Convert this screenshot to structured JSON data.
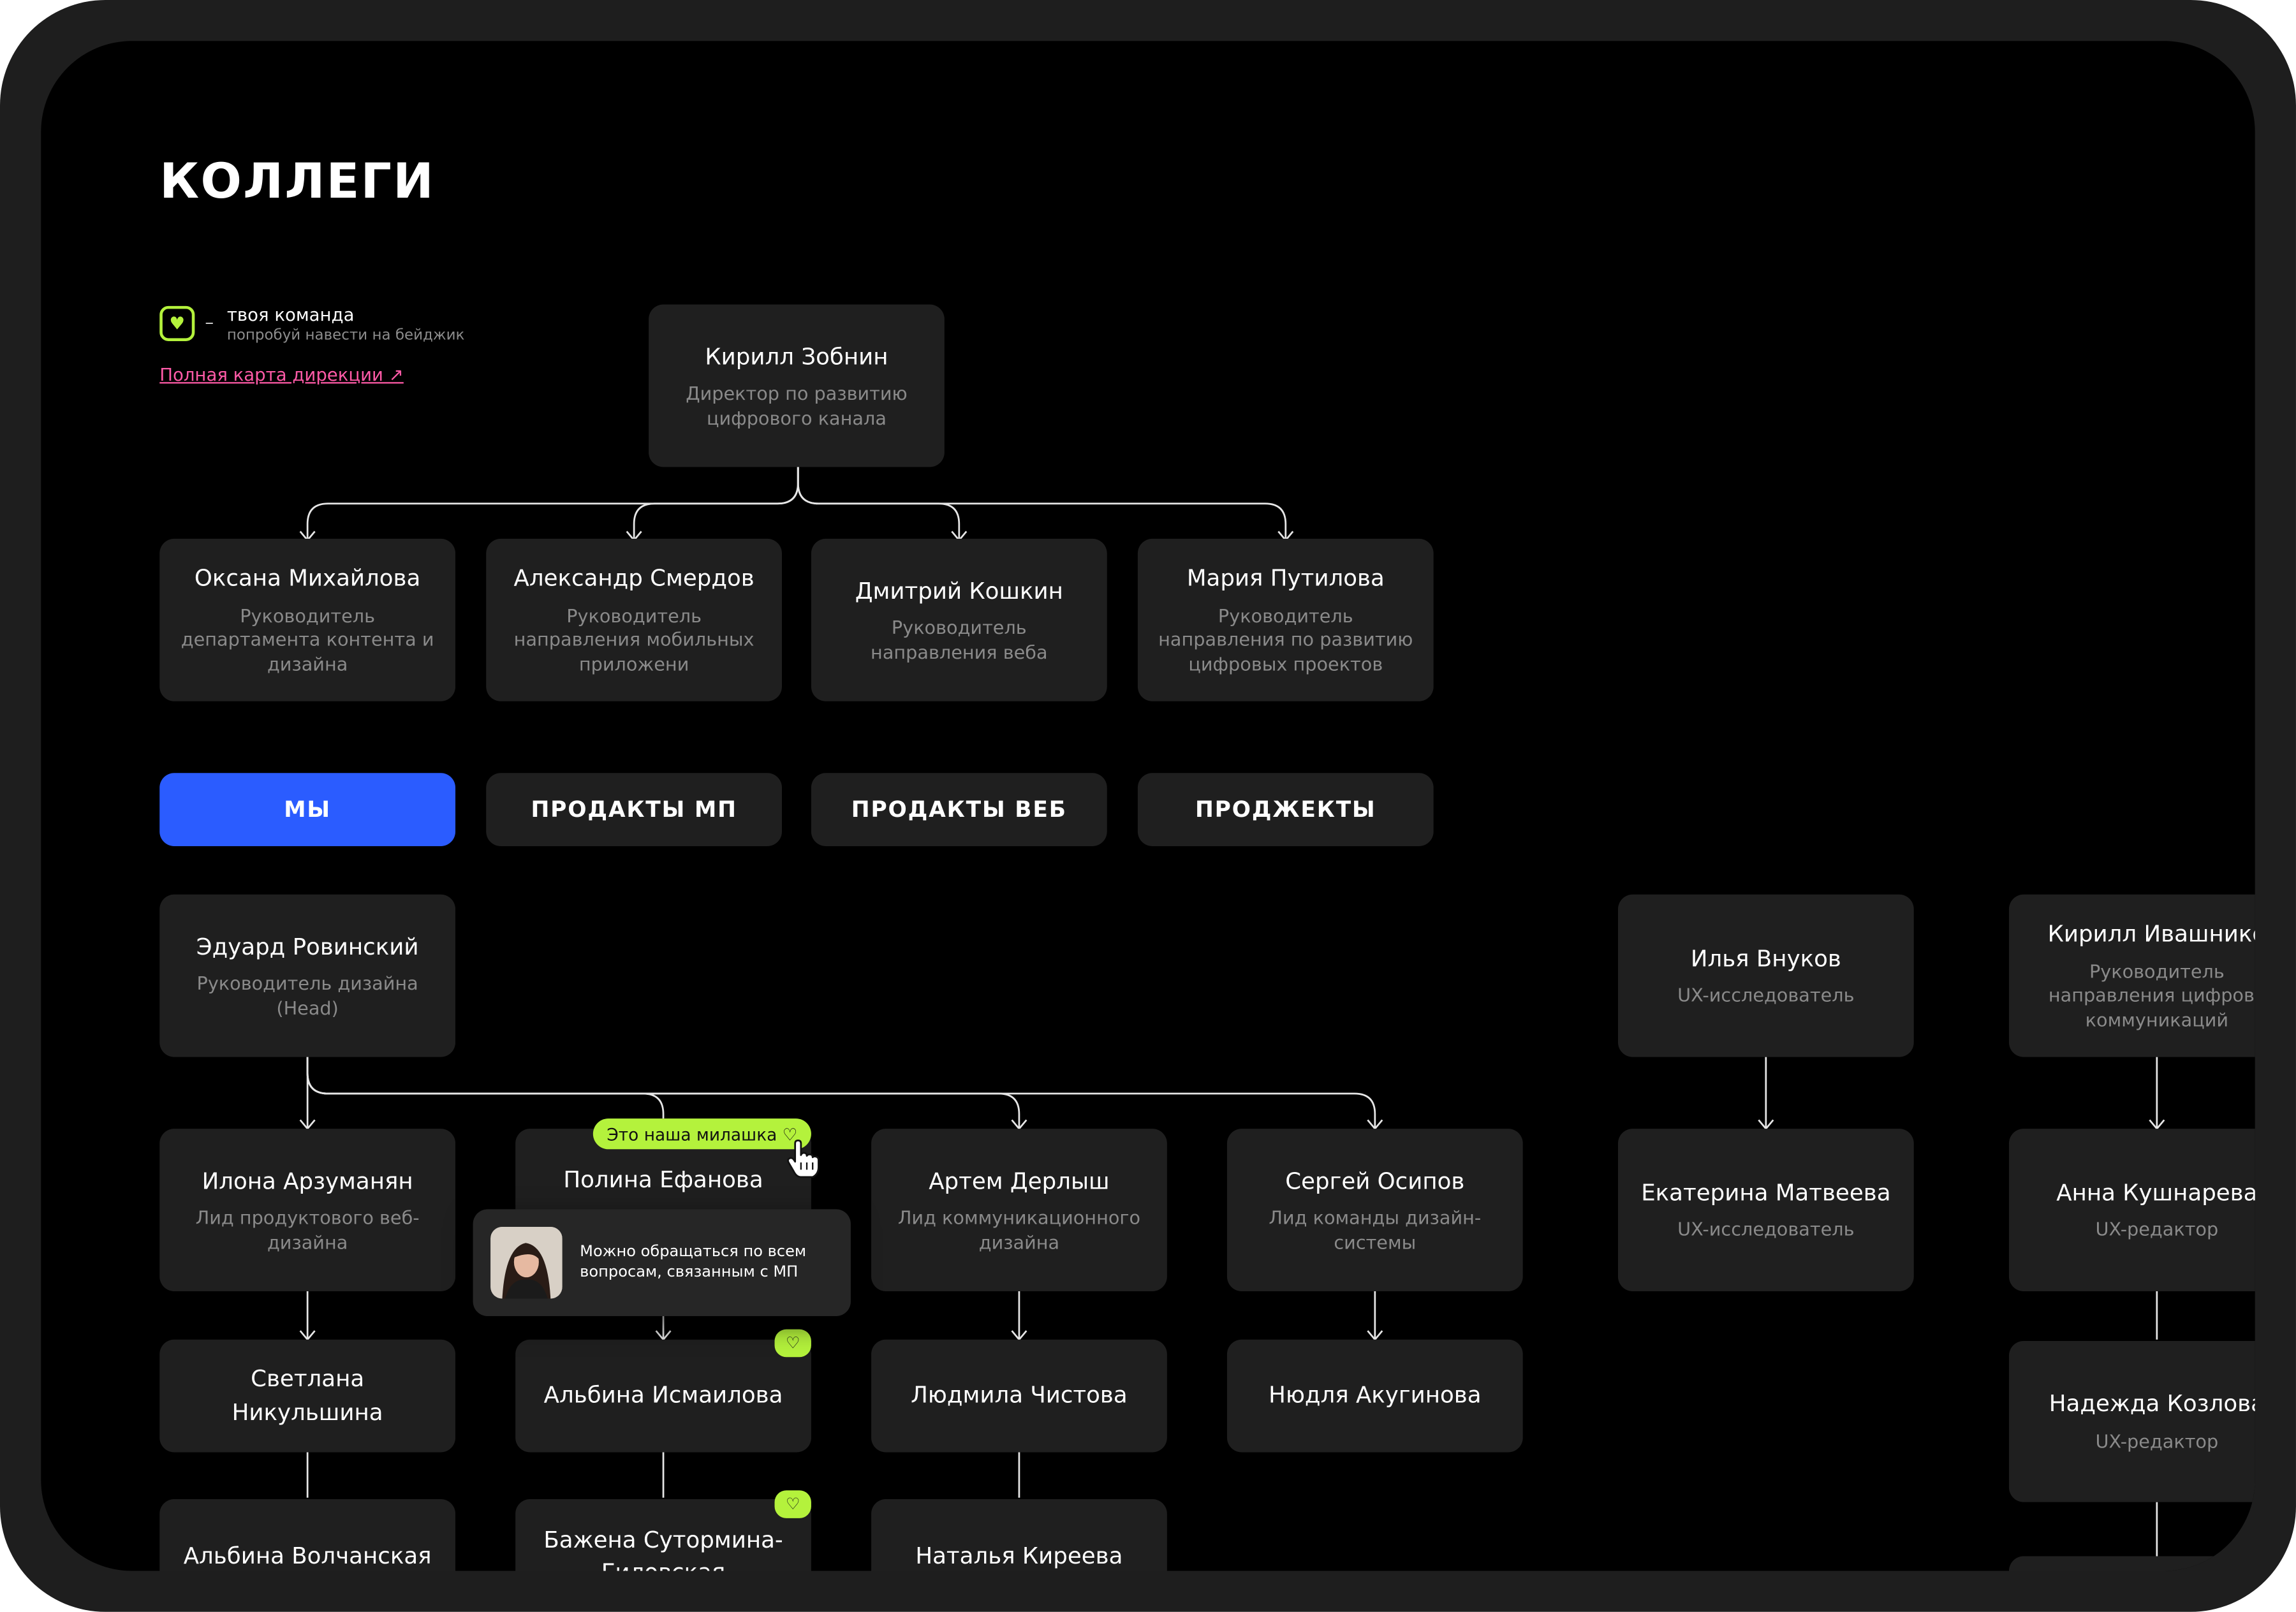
{
  "page": {
    "title": "КОЛЛЕГИ",
    "legend": {
      "icon": "heart-badge-icon",
      "dash": "–",
      "title": "твоя команда",
      "hint": "попробуй навести на бейджик"
    },
    "full_map_link": "Полная карта дирекции ↗"
  },
  "colors": {
    "background": "#000000",
    "card": "#1f1f1f",
    "accent_blue": "#2b5cff",
    "accent_green": "#b4f23c",
    "link_pink": "#ff5aa7"
  },
  "director": {
    "name": "Кирилл Зобнин",
    "role": "Директор по развитию цифрового канала"
  },
  "heads": [
    {
      "name": "Оксана Михайлова",
      "role": "Руководитель департамента контента и дизайна"
    },
    {
      "name": "Александр Смердов",
      "role": "Руководитель направления мобильных приложени"
    },
    {
      "name": "Дмитрий Кошкин",
      "role": "Руководитель направления веба"
    },
    {
      "name": "Мария Путилова",
      "role": "Руководитель направления по развитию цифровых проектов"
    }
  ],
  "tabs": [
    {
      "label": "МЫ",
      "active": true
    },
    {
      "label": "ПРОДАКТЫ МП",
      "active": false
    },
    {
      "label": "ПРОДАКТЫ ВЕБ",
      "active": false
    },
    {
      "label": "ПРОДЖЕКТЫ",
      "active": false
    }
  ],
  "design_head": {
    "name": "Эдуард Ровинский",
    "role": "Руководитель дизайна (Head)"
  },
  "leads": [
    {
      "name": "Илона Арзуманян",
      "role": "Лид продуктового веб-дизайна"
    },
    {
      "name": "Полина Ефанова",
      "role": ""
    },
    {
      "name": "Артем Дерлыш",
      "role": "Лид коммуникационного дизайна"
    },
    {
      "name": "Сергей Осипов",
      "role": "Лид команды дизайн-системы"
    }
  ],
  "members_row1": [
    {
      "name": "Светлана Никульшина",
      "team": false
    },
    {
      "name": "Альбина Исмаилова",
      "team": true
    },
    {
      "name": "Людмила Чистова",
      "team": false
    },
    {
      "name": "Нюдля Акугинова",
      "team": false
    }
  ],
  "members_row2": [
    {
      "name": "Альбина Волчанская",
      "team": false
    },
    {
      "name": "Бажена Сутормина-Гиловская",
      "team": true
    },
    {
      "name": "Наталья Киреева",
      "team": false
    }
  ],
  "team_badge": "♡",
  "tooltip": {
    "pill": "Это наша милашка ♡",
    "text": "Можно обращаться по всем вопросам, связанным с МП"
  },
  "research": {
    "top": {
      "name": "Илья Внуков",
      "role": "UX-исследователь"
    },
    "bottom": {
      "name": "Екатерина Матвеева",
      "role": "UX-исследователь"
    }
  },
  "ux_writing": {
    "top": {
      "name": "Кирилл Ивашнико",
      "role": "Руководитель направления цифровь коммуникаций"
    },
    "middle": {
      "name": "Анна Кушнарева",
      "role": "UX-редактор"
    },
    "bottom": {
      "name": "Надежда Козлова",
      "role": "UX-редактор"
    }
  }
}
